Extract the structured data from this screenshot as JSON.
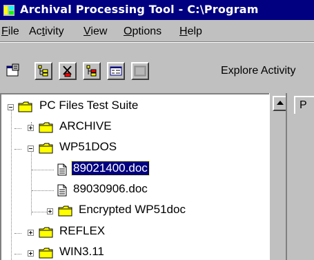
{
  "window": {
    "title": "Archival Processing Tool - C:\\Program",
    "app_icon": "app-icon"
  },
  "menu": {
    "items": [
      {
        "label": "File",
        "mnemonic": "F"
      },
      {
        "label": "Activity",
        "mnemonic": "t"
      },
      {
        "label": "View",
        "mnemonic": "V"
      },
      {
        "label": "Options",
        "mnemonic": "O"
      },
      {
        "label": "Help",
        "mnemonic": "H"
      }
    ]
  },
  "toolbar": {
    "buttons": [
      {
        "icon": "properties-icon",
        "state": "normal"
      },
      {
        "icon": "folder-tree-icon",
        "state": "raised"
      },
      {
        "icon": "tool-icon",
        "state": "raised"
      },
      {
        "icon": "select-tree-icon",
        "state": "raised"
      },
      {
        "icon": "form-icon",
        "state": "raised"
      },
      {
        "icon": "disabled-icon",
        "state": "disabled"
      }
    ],
    "explore_label": "Explore Activity"
  },
  "tree": {
    "nodes": [
      {
        "label": "PC Files Test Suite",
        "type": "folder",
        "level": 0,
        "expander": "minus"
      },
      {
        "label": "ARCHIVE",
        "type": "folder",
        "level": 1,
        "expander": "plus"
      },
      {
        "label": "WP51DOS",
        "type": "folder",
        "level": 1,
        "expander": "minus"
      },
      {
        "label": "89021400.doc",
        "type": "document",
        "level": 2,
        "selected": true
      },
      {
        "label": "89030906.doc",
        "type": "document",
        "level": 2
      },
      {
        "label": "Encrypted WP51doc",
        "type": "folder",
        "level": 2,
        "expander": "plus"
      },
      {
        "label": "REFLEX",
        "type": "folder",
        "level": 1,
        "expander": "plus"
      },
      {
        "label": "WIN3.11",
        "type": "folder",
        "level": 1,
        "expander": "plus"
      }
    ]
  },
  "right_panel": {
    "tab_label": "P"
  },
  "colors": {
    "titlebar": "#000080",
    "selection": "#000080",
    "folder": "#ffff00",
    "face": "#c0c0c0"
  }
}
